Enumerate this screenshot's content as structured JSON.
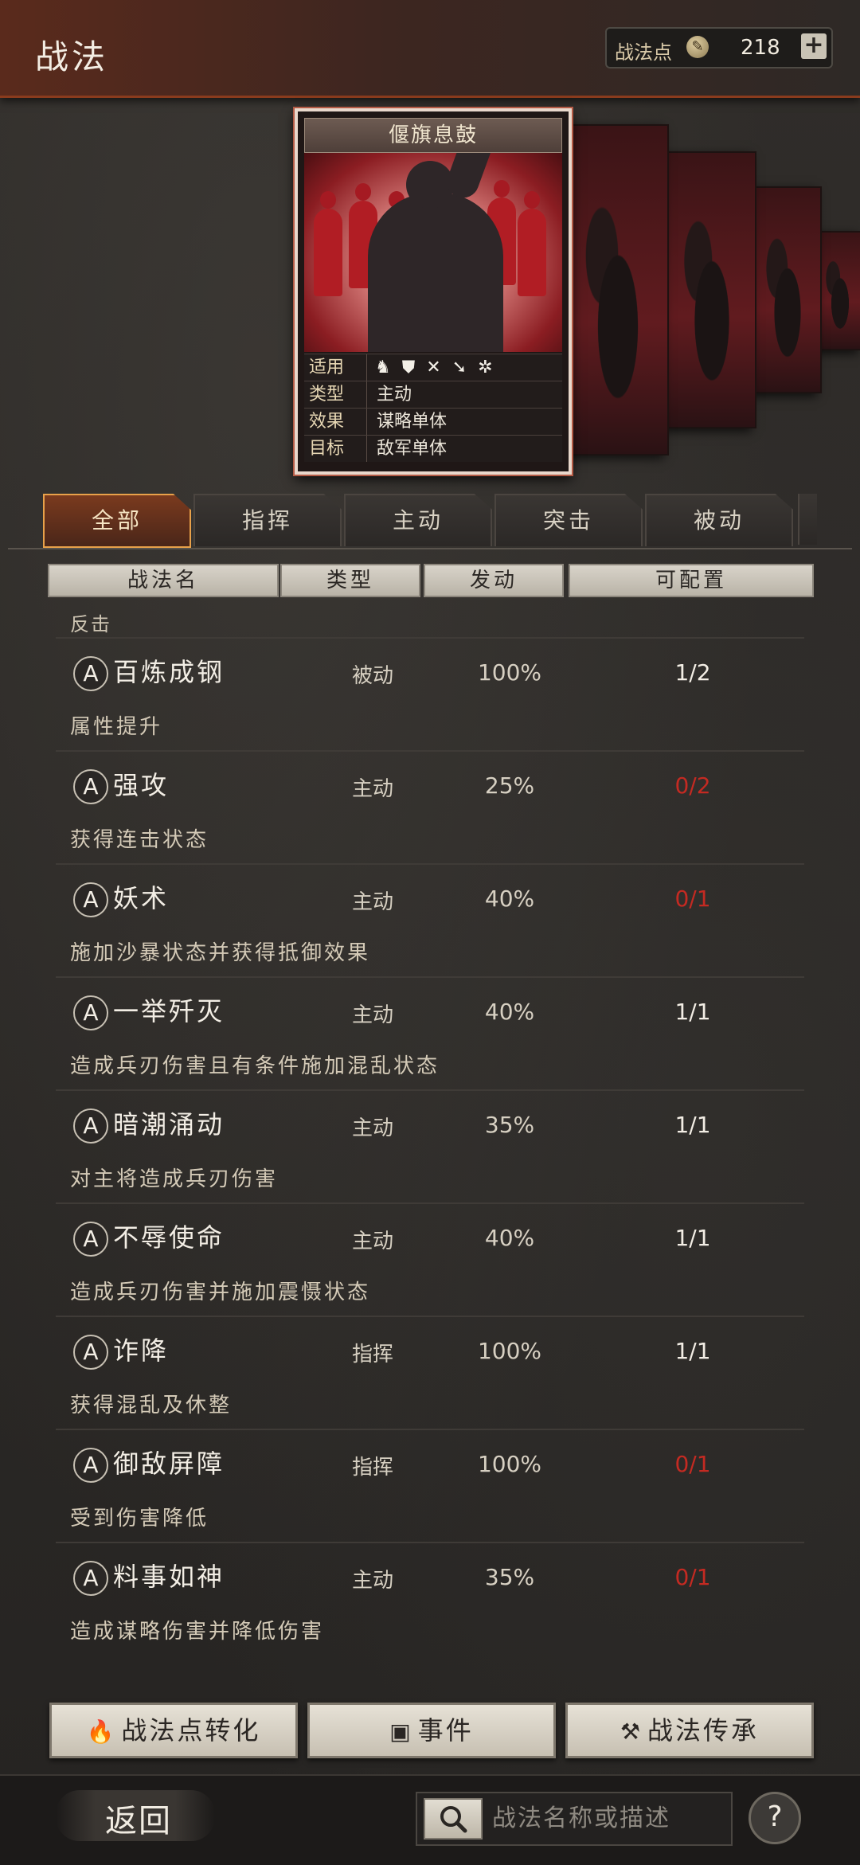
{
  "header": {
    "title": "战法",
    "points_label": "战法点",
    "points_value": "218",
    "add_label": "+"
  },
  "card": {
    "name": "偃旗息鼓",
    "rows": [
      {
        "key": "适用",
        "value": ""
      },
      {
        "key": "类型",
        "value": "主动"
      },
      {
        "key": "效果",
        "value": "谋略单体"
      },
      {
        "key": "目标",
        "value": "敌军单体"
      }
    ],
    "applicable_icons": [
      "cavalry-icon",
      "shield-icon",
      "bow-icon",
      "spear-icon",
      "wheel-icon"
    ]
  },
  "tabs": [
    "全部",
    "指挥",
    "主动",
    "突击",
    "被动"
  ],
  "columns": [
    "战法名",
    "类型",
    "发动",
    "可配置"
  ],
  "partial_desc": "反击",
  "rows": [
    {
      "rank": "A",
      "name": "百炼成钢",
      "type": "被动",
      "trigger": "100%",
      "config": "1/2",
      "desc": "属性提升",
      "available": true
    },
    {
      "rank": "A",
      "name": "强攻",
      "type": "主动",
      "trigger": "25%",
      "config": "0/2",
      "desc": "获得连击状态",
      "available": false
    },
    {
      "rank": "A",
      "name": "妖术",
      "type": "主动",
      "trigger": "40%",
      "config": "0/1",
      "desc": "施加沙暴状态并获得抵御效果",
      "available": false
    },
    {
      "rank": "A",
      "name": "一举歼灭",
      "type": "主动",
      "trigger": "40%",
      "config": "1/1",
      "desc": "造成兵刃伤害且有条件施加混乱状态",
      "available": true
    },
    {
      "rank": "A",
      "name": "暗潮涌动",
      "type": "主动",
      "trigger": "35%",
      "config": "1/1",
      "desc": "对主将造成兵刃伤害",
      "available": true
    },
    {
      "rank": "A",
      "name": "不辱使命",
      "type": "主动",
      "trigger": "40%",
      "config": "1/1",
      "desc": "造成兵刃伤害并施加震慑状态",
      "available": true
    },
    {
      "rank": "A",
      "name": "诈降",
      "type": "指挥",
      "trigger": "100%",
      "config": "1/1",
      "desc": "获得混乱及休整",
      "available": true
    },
    {
      "rank": "A",
      "name": "御敌屏障",
      "type": "指挥",
      "trigger": "100%",
      "config": "0/1",
      "desc": "受到伤害降低",
      "available": false
    },
    {
      "rank": "A",
      "name": "料事如神",
      "type": "主动",
      "trigger": "35%",
      "config": "0/1",
      "desc": "造成谋略伤害并降低伤害",
      "available": false
    }
  ],
  "buttons": {
    "convert": "战法点转化",
    "events": "事件",
    "inherit": "战法传承"
  },
  "footer": {
    "back": "返回",
    "search_placeholder": "战法名称或描述",
    "help": "?"
  },
  "colors": {
    "accent": "#e8a14a",
    "unavailable": "#c42a22",
    "header_red": "#5a2a1c"
  }
}
